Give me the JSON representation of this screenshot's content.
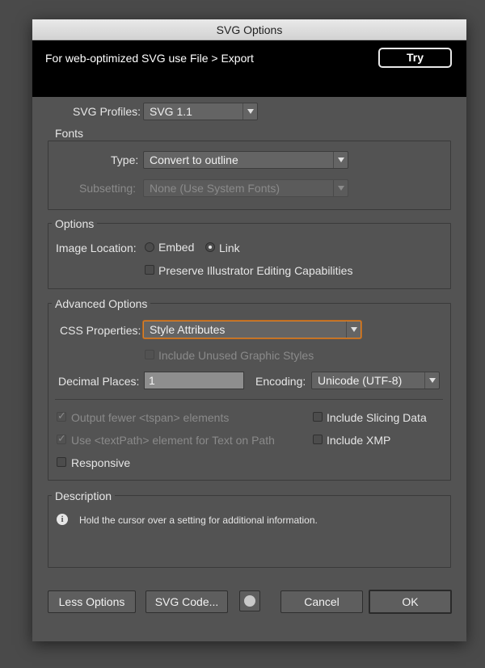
{
  "window": {
    "title": "SVG Options"
  },
  "banner": {
    "text": "For web-optimized SVG use File > Export",
    "try_label": "Try"
  },
  "profiles": {
    "label": "SVG Profiles:",
    "value": "SVG 1.1"
  },
  "fonts": {
    "legend": "Fonts",
    "type_label": "Type:",
    "type_value": "Convert to outline",
    "subsetting_label": "Subsetting:",
    "subsetting_value": "None (Use System Fonts)"
  },
  "options": {
    "legend": "Options",
    "image_location_label": "Image Location:",
    "embed_label": "Embed",
    "link_label": "Link",
    "selected": "Link",
    "preserve_label": "Preserve Illustrator Editing Capabilities",
    "preserve_checked": false
  },
  "advanced": {
    "legend": "Advanced Options",
    "css_label": "CSS Properties:",
    "css_value": "Style Attributes",
    "include_unused_label": "Include Unused Graphic Styles",
    "decimal_label": "Decimal Places:",
    "decimal_value": "1",
    "encoding_label": "Encoding:",
    "encoding_value": "Unicode (UTF-8)",
    "output_fewer_label": "Output fewer <tspan> elements",
    "textpath_label": "Use <textPath> element for Text on Path",
    "responsive_label": "Responsive",
    "slicing_label": "Include Slicing Data",
    "xmp_label": "Include XMP"
  },
  "description": {
    "legend": "Description",
    "text": "Hold the cursor over a setting for additional information.",
    "icon": "info-icon"
  },
  "footer": {
    "less_options": "Less Options",
    "svg_code": "SVG Code...",
    "globe_icon": "globe-icon",
    "cancel": "Cancel",
    "ok": "OK"
  },
  "colors": {
    "dialog_bg": "#535353",
    "banner_bg": "#000000",
    "focus_ring": "#d9822b"
  }
}
